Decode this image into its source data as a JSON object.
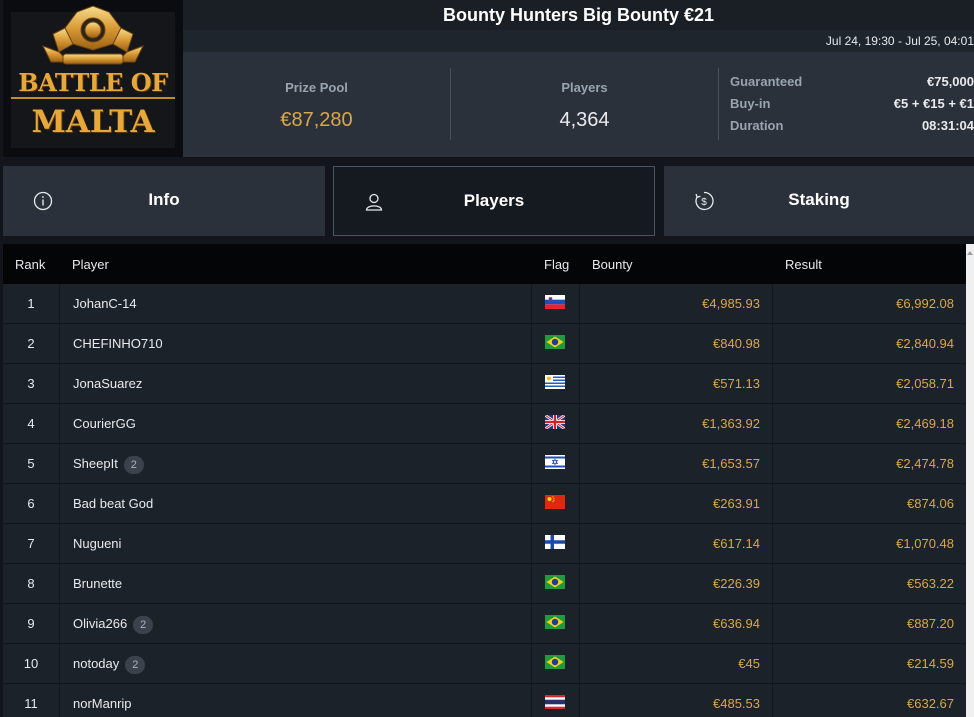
{
  "logo": {
    "line1": "BATTLE OF",
    "line2": "MALTA"
  },
  "header": {
    "title": "Bounty Hunters Big Bounty €21",
    "date_range": "Jul 24, 19:30 - Jul 25, 04:01"
  },
  "stats": {
    "prize_pool_label": "Prize Pool",
    "prize_pool_value": "€87,280",
    "players_label": "Players",
    "players_value": "4,364"
  },
  "details": {
    "guaranteed_label": "Guaranteed",
    "guaranteed_value": "€75,000",
    "buyin_label": "Buy-in",
    "buyin_value": "€5 + €15 + €1",
    "duration_label": "Duration",
    "duration_value": "08:31:04"
  },
  "tabs": [
    {
      "label": "Info",
      "icon": "info-icon"
    },
    {
      "label": "Players",
      "icon": "user-icon"
    },
    {
      "label": "Staking",
      "icon": "dollar-icon"
    }
  ],
  "table": {
    "columns": {
      "rank": "Rank",
      "player": "Player",
      "flag": "Flag",
      "bounty": "Bounty",
      "result": "Result"
    },
    "rows": [
      {
        "rank": "1",
        "player": "JohanC-14",
        "badge": "",
        "flag": "slovenia-flag-icon",
        "bounty": "€4,985.93",
        "result": "€6,992.08"
      },
      {
        "rank": "2",
        "player": "CHEFINHO710",
        "badge": "",
        "flag": "brazil-flag-icon",
        "bounty": "€840.98",
        "result": "€2,840.94"
      },
      {
        "rank": "3",
        "player": "JonaSuarez",
        "badge": "",
        "flag": "uruguay-flag-icon",
        "bounty": "€571.13",
        "result": "€2,058.71"
      },
      {
        "rank": "4",
        "player": "CourierGG",
        "badge": "",
        "flag": "uk-flag-icon",
        "bounty": "€1,363.92",
        "result": "€2,469.18"
      },
      {
        "rank": "5",
        "player": "SheepIt",
        "badge": "2",
        "flag": "israel-flag-icon",
        "bounty": "€1,653.57",
        "result": "€2,474.78"
      },
      {
        "rank": "6",
        "player": "Bad beat God",
        "badge": "",
        "flag": "china-flag-icon",
        "bounty": "€263.91",
        "result": "€874.06"
      },
      {
        "rank": "7",
        "player": "Nugueni",
        "badge": "",
        "flag": "finland-flag-icon",
        "bounty": "€617.14",
        "result": "€1,070.48"
      },
      {
        "rank": "8",
        "player": "Brunette",
        "badge": "",
        "flag": "brazil-flag-icon",
        "bounty": "€226.39",
        "result": "€563.22"
      },
      {
        "rank": "9",
        "player": "Olivia266",
        "badge": "2",
        "flag": "brazil-flag-icon",
        "bounty": "€636.94",
        "result": "€887.20"
      },
      {
        "rank": "10",
        "player": "notoday",
        "badge": "2",
        "flag": "brazil-flag-icon",
        "bounty": "€45",
        "result": "€214.59"
      },
      {
        "rank": "11",
        "player": "norManrip",
        "badge": "",
        "flag": "thailand-flag-icon",
        "bounty": "€485.53",
        "result": "€632.67"
      }
    ]
  },
  "colors": {
    "gold": "#d9a74a",
    "background": "#12161c",
    "panel": "#2a313a"
  }
}
